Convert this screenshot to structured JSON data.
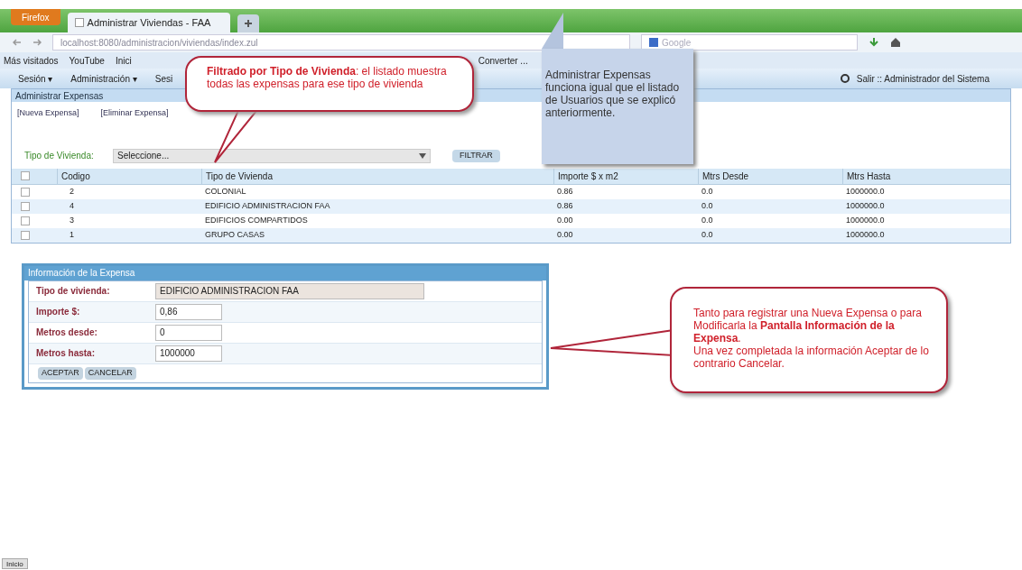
{
  "browser": {
    "menu_button": "Firefox",
    "tab": {
      "title": "Administrar Viviendas - FAA",
      "selected": true
    },
    "url": "localhost:8080/administracion/viviendas/index.zul",
    "search_placeholder": "Google",
    "bookmarks": [
      "Más visitados",
      "YouTube",
      "Inici",
      "Converter ..."
    ]
  },
  "app_menu": {
    "items": [
      "Sesión ▾",
      "Administración ▾",
      "Sesi"
    ],
    "user": "Salir :: Administrador del Sistema"
  },
  "panel": {
    "title": "Administrar Expensas",
    "links": [
      "[Nueva Expensa]",
      "[Eliminar Expensa]"
    ],
    "filter": {
      "label": "Tipo de Vivienda:",
      "placeholder": "Seleccione...",
      "button": "FILTRAR"
    },
    "table": {
      "header_checked": false,
      "columns": [
        "Codigo",
        "Tipo de Vivienda",
        "Importe $ x m2",
        "Mtrs Desde",
        "Mtrs Hasta"
      ],
      "rows": [
        {
          "checked": false,
          "cells": [
            "2",
            "COLONIAL",
            "0.86",
            "0.0",
            "1000000.0"
          ]
        },
        {
          "checked": false,
          "cells": [
            "4",
            "EDIFICIO ADMINISTRACION FAA",
            "0.86",
            "0.0",
            "1000000.0"
          ]
        },
        {
          "checked": false,
          "cells": [
            "3",
            "EDIFICIOS COMPARTIDOS",
            "0.00",
            "0.0",
            "1000000.0"
          ]
        },
        {
          "checked": false,
          "cells": [
            "1",
            "GRUPO CASAS",
            "0.00",
            "0.0",
            "1000000.0"
          ]
        }
      ]
    }
  },
  "form": {
    "title": "Información de la Expensa",
    "fields": [
      {
        "label": "Tipo de vivienda:",
        "value": "EDIFICIO ADMINISTRACION FAA",
        "disabled": true
      },
      {
        "label": "Importe $:",
        "value": "0,86",
        "disabled": false
      },
      {
        "label": "Metros desde:",
        "value": "0",
        "disabled": false
      },
      {
        "label": "Metros hasta:",
        "value": "1000000",
        "disabled": false
      }
    ],
    "buttons": [
      "ACEPTAR",
      "CANCELAR"
    ]
  },
  "footer_button": "Inicio",
  "notes": [
    {
      "kind": "callout",
      "paragraphs": [
        "**Filtrado por Tipo de Vivienda**: el listado muestra todas las expensas para ese tipo de vivienda"
      ]
    },
    {
      "kind": "sticky",
      "paragraphs": [
        "Administrar Expensas funciona igual que el listado de Usuarios que se explicó anteriormente."
      ]
    },
    {
      "kind": "callout",
      "paragraphs": [
        "Tanto para registrar una Nueva Expensa o para Modificarla la **Pantalla Información de la Expensa**.",
        "Una vez completada la información Aceptar de lo contrario Cancelar."
      ]
    }
  ]
}
